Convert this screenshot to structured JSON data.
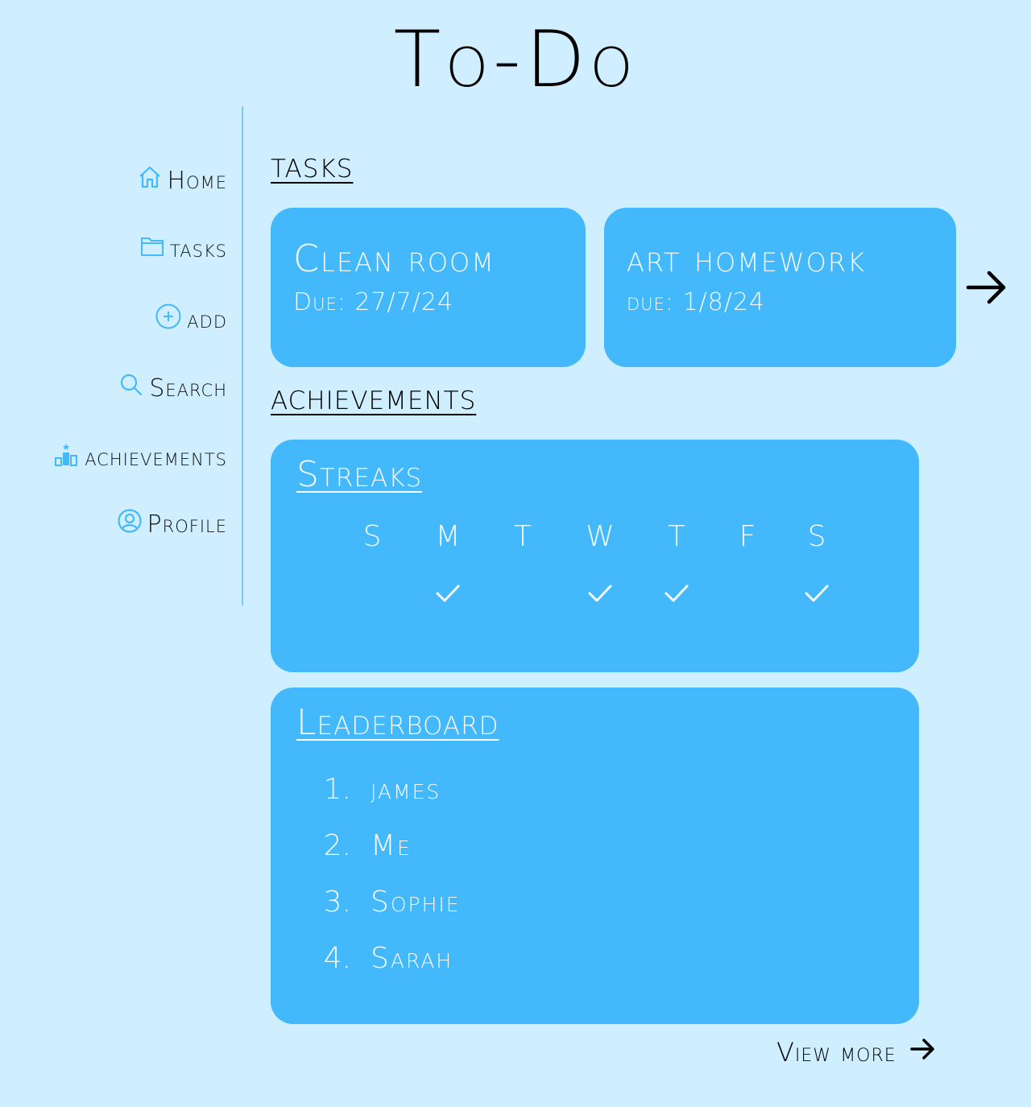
{
  "app": {
    "title": "To-Do",
    "accent_color": "#43b8fb",
    "background_color": "#cfeeff"
  },
  "sidebar": {
    "items": [
      {
        "label": "Home",
        "icon": "home-icon"
      },
      {
        "label": "tasks",
        "icon": "folder-icon"
      },
      {
        "label": "add",
        "icon": "plus-circle-icon"
      },
      {
        "label": "Search",
        "icon": "search-icon"
      },
      {
        "label": "achievements",
        "icon": "podium-icon"
      },
      {
        "label": "Profile",
        "icon": "user-circle-icon"
      }
    ]
  },
  "tasks": {
    "heading": "tasks",
    "cards": [
      {
        "title": "Clean room",
        "due": "Due: 27/7/24"
      },
      {
        "title": "art homework",
        "due": "due: 1/8/24"
      }
    ],
    "next_icon": "arrow-right-icon"
  },
  "achievements": {
    "heading": "achievements",
    "streaks": {
      "heading": "Streaks",
      "days": [
        "S",
        "M",
        "T",
        "W",
        "T",
        "F",
        "S"
      ],
      "completed": [
        false,
        true,
        false,
        true,
        true,
        false,
        true
      ]
    },
    "leaderboard": {
      "heading": "Leaderboard",
      "entries": [
        {
          "rank": "1.",
          "name": "james"
        },
        {
          "rank": "2.",
          "name": "Me"
        },
        {
          "rank": "3.",
          "name": "Sophie"
        },
        {
          "rank": "4.",
          "name": "Sarah"
        }
      ]
    },
    "view_more": "View more"
  }
}
